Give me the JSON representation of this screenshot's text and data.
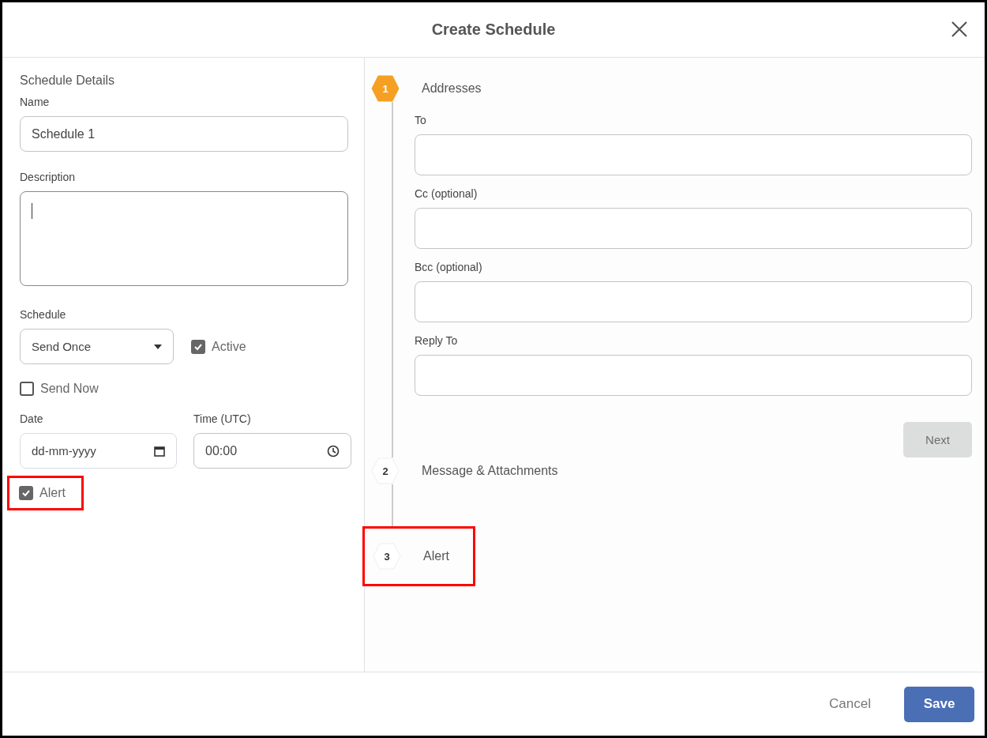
{
  "dialog": {
    "title": "Create Schedule"
  },
  "details": {
    "heading": "Schedule Details",
    "name": {
      "label": "Name",
      "value": "Schedule 1"
    },
    "description": {
      "label": "Description"
    },
    "schedule": {
      "label": "Schedule",
      "value": "Send Once"
    },
    "active": {
      "label": "Active",
      "checked": true
    },
    "send_now": {
      "label": "Send Now",
      "checked": false
    },
    "date": {
      "label": "Date",
      "placeholder": "dd-mm-yyyy"
    },
    "time": {
      "label": "Time (UTC)",
      "value": "00:00"
    },
    "alert": {
      "label": "Alert",
      "checked": true,
      "highlighted": true
    }
  },
  "steps": [
    {
      "number": "1",
      "label": "Addresses",
      "selected": true,
      "highlighted": false
    },
    {
      "number": "2",
      "label": "Message & Attachments",
      "selected": false,
      "highlighted": false
    },
    {
      "number": "3",
      "label": "Alert",
      "selected": false,
      "highlighted": true
    }
  ],
  "address_fields": [
    {
      "label": "To"
    },
    {
      "label": "Cc (optional)"
    },
    {
      "label": "Bcc (optional)"
    },
    {
      "label": "Reply To"
    }
  ],
  "next_button": {
    "label": "Next",
    "disabled": true
  },
  "footer": {
    "cancel": "Cancel",
    "save": "Save"
  }
}
